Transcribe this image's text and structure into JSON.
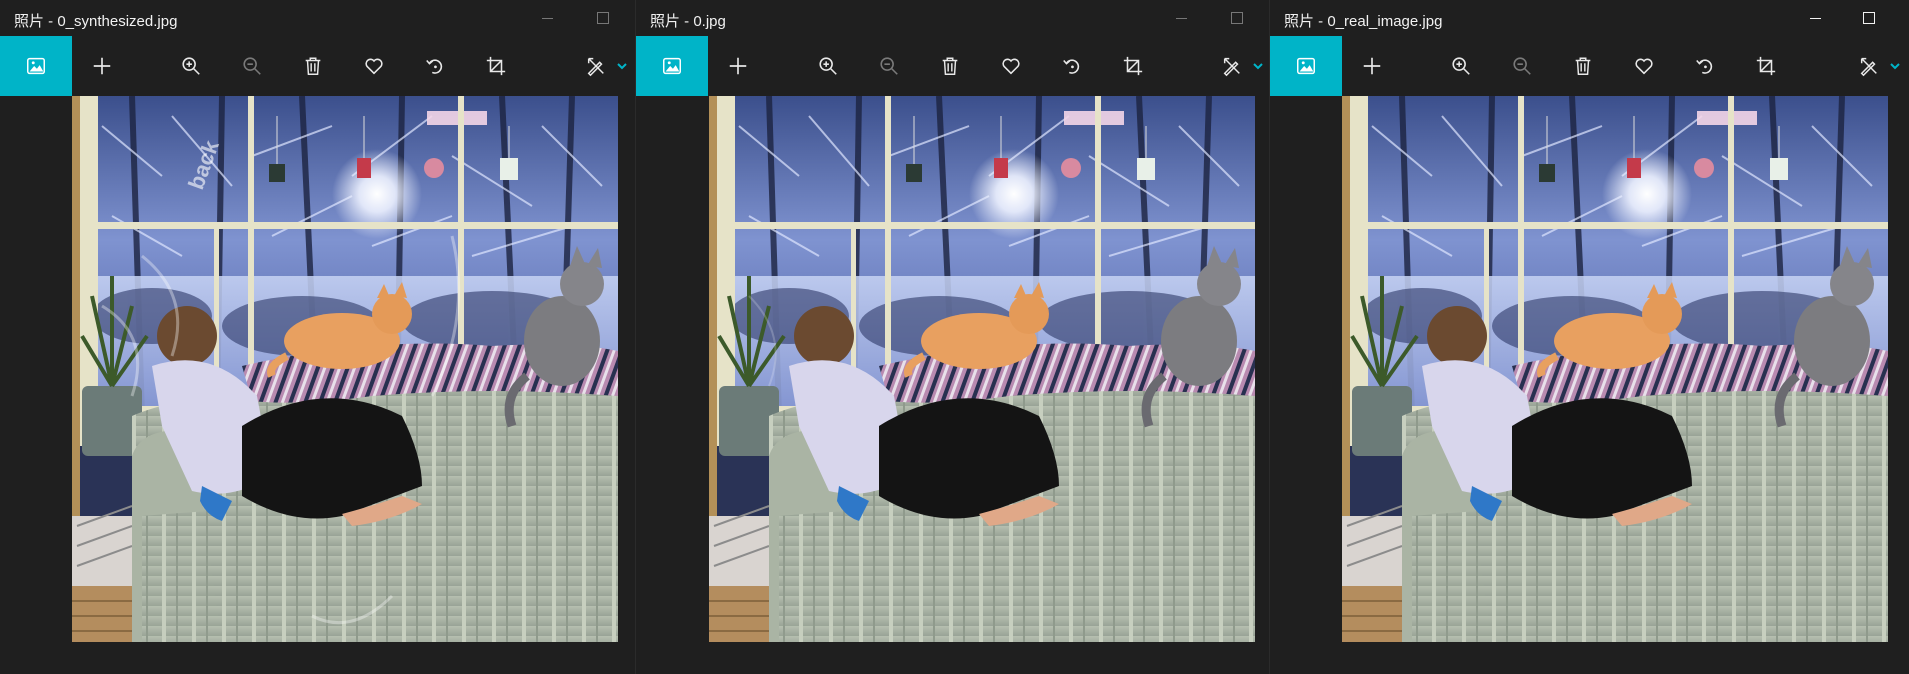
{
  "windows": [
    {
      "title": "照片 - 0_synthesized.jpg",
      "max_active": false
    },
    {
      "title": "照片 - 0.jpg",
      "max_active": false
    },
    {
      "title": "照片 - 0_real_image.jpg",
      "max_active": true
    }
  ],
  "toolbar_icons": [
    "photo-icon",
    "add-icon",
    "zoom-in-icon",
    "zoom-out-icon",
    "delete-icon",
    "favorite-icon",
    "rotate-icon",
    "crop-icon",
    "edit-icon"
  ],
  "colors": {
    "accent": "#00b4c8",
    "background": "#1f1f1f",
    "icon": "#e8e8e8"
  },
  "watermark_text": "back"
}
